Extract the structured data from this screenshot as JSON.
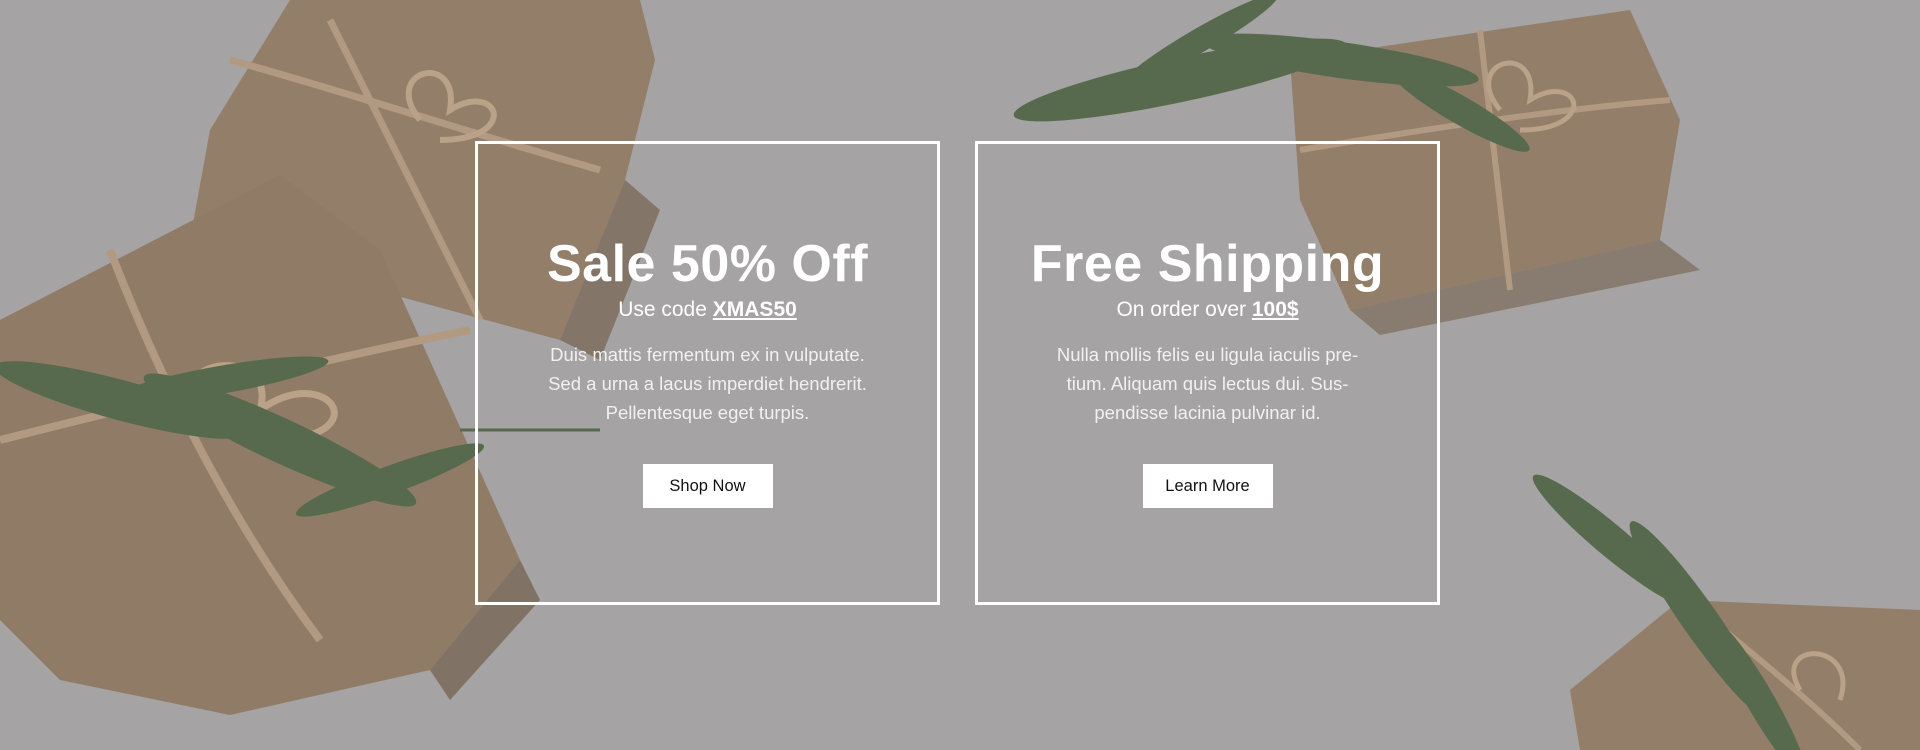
{
  "colors": {
    "background": "#a7a6a6",
    "kraft_paper": "#8f7558",
    "twine": "#b79a78",
    "greenery": "#3f5a34",
    "frame": "#ffffff",
    "button_bg": "#ffffff",
    "button_text": "#111111"
  },
  "decor": {
    "background_image": "gift-boxes-photo",
    "icons": [
      "gift-box-icon",
      "pine-branch-icon",
      "twine-bow-icon"
    ]
  },
  "promo_left": {
    "title": "Sale 50% Off",
    "subtitle_prefix": "Use code ",
    "subtitle_code": "XMAS50",
    "body_line1": "Duis mattis fermentum ex in vulputate.",
    "body_line2": "Sed a urna a lacus imperdiet hendrerit.",
    "body_line3": "Pellentesque eget turpis.",
    "button_label": "Shop Now"
  },
  "promo_right": {
    "title": "Free Shipping",
    "subtitle_prefix": "On order over ",
    "subtitle_code": "100$",
    "body_line1": "Nulla mollis felis eu ligula iaculis pre-",
    "body_line2": "tium. Aliquam quis lectus dui. Sus-",
    "body_line3": "pendisse lacinia pulvinar id.",
    "button_label": "Learn More"
  }
}
